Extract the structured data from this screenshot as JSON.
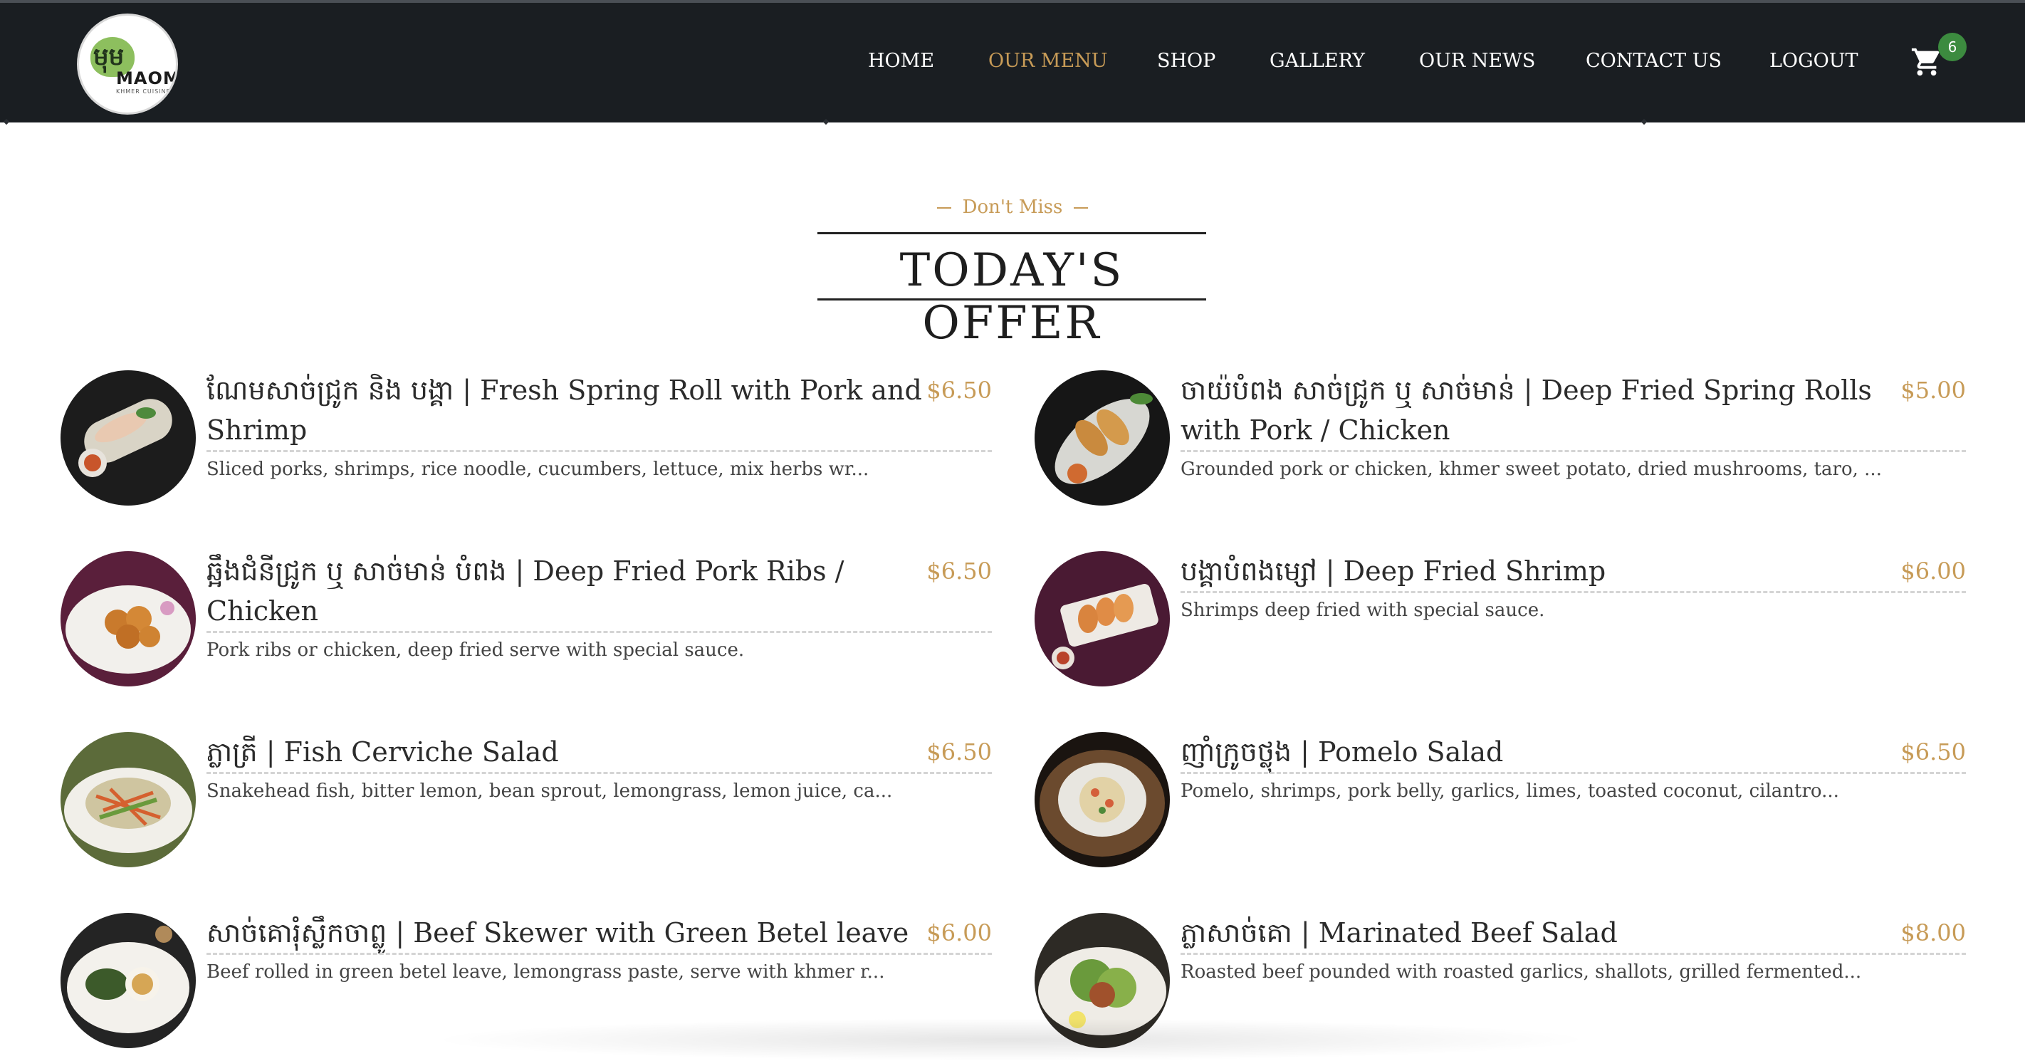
{
  "brand": {
    "logo_khmer": "មុម",
    "logo_text": "MAOM",
    "logo_sub": "KHMER CUISINE"
  },
  "nav": {
    "items": [
      "HOME",
      "OUR MENU",
      "SHOP",
      "GALLERY",
      "OUR NEWS",
      "CONTACT US",
      "LOGOUT"
    ],
    "active": "OUR MENU",
    "cart_icon": "shopping-cart-icon",
    "cart_count": "6"
  },
  "colors": {
    "header_bg": "#1a1e22",
    "accent": "#c79b57",
    "badge": "#3c8b3f"
  },
  "section": {
    "subtitle": "Don't Miss",
    "title": "TODAY'S OFFER"
  },
  "menu": [
    {
      "name": "ណែមសាច់ជ្រូក និង បង្គា | Fresh Spring Roll with Pork and Shrimp",
      "price": "$6.50",
      "description": "Sliced porks, shrimps, rice noodle, cucumbers, lettuce, mix herbs wr..."
    },
    {
      "name": "ចាយ៉បំពង សាច់ជ្រូក ឬ សាច់មាន់ | Deep Fried Spring Rolls with Pork / Chicken",
      "price": "$5.00",
      "description": "Grounded pork or chicken, khmer sweet potato, dried mushrooms, taro, ..."
    },
    {
      "name": "ឆ្អឹងជំនីជ្រូក ឬ សាច់មាន់ បំពង | Deep Fried Pork Ribs / Chicken",
      "price": "$6.50",
      "description": "Pork ribs or chicken, deep fried serve with special sauce."
    },
    {
      "name": "បង្គាបំពងម្សៅ | Deep Fried Shrimp",
      "price": "$6.00",
      "description": "Shrimps deep fried with special sauce."
    },
    {
      "name": "ភ្លាត្រី | Fish Cerviche Salad",
      "price": "$6.50",
      "description": "Snakehead fish, bitter lemon, bean sprout, lemongrass, lemon juice, ca..."
    },
    {
      "name": "ញាំក្រូចថ្លុង | Pomelo Salad",
      "price": "$6.50",
      "description": "Pomelo, shrimps, pork belly, garlics, limes, toasted coconut, cilantro..."
    },
    {
      "name": "សាច់គោរុំស្លឹកចាព្លូ | Beef Skewer with Green Betel leave",
      "price": "$6.00",
      "description": "Beef rolled in green betel leave, lemongrass paste, serve with khmer r..."
    },
    {
      "name": "ភ្លាសាច់គោ | Marinated Beef Salad",
      "price": "$8.00",
      "description": "Roasted beef pounded with roasted garlics, shallots, grilled fermented..."
    }
  ]
}
